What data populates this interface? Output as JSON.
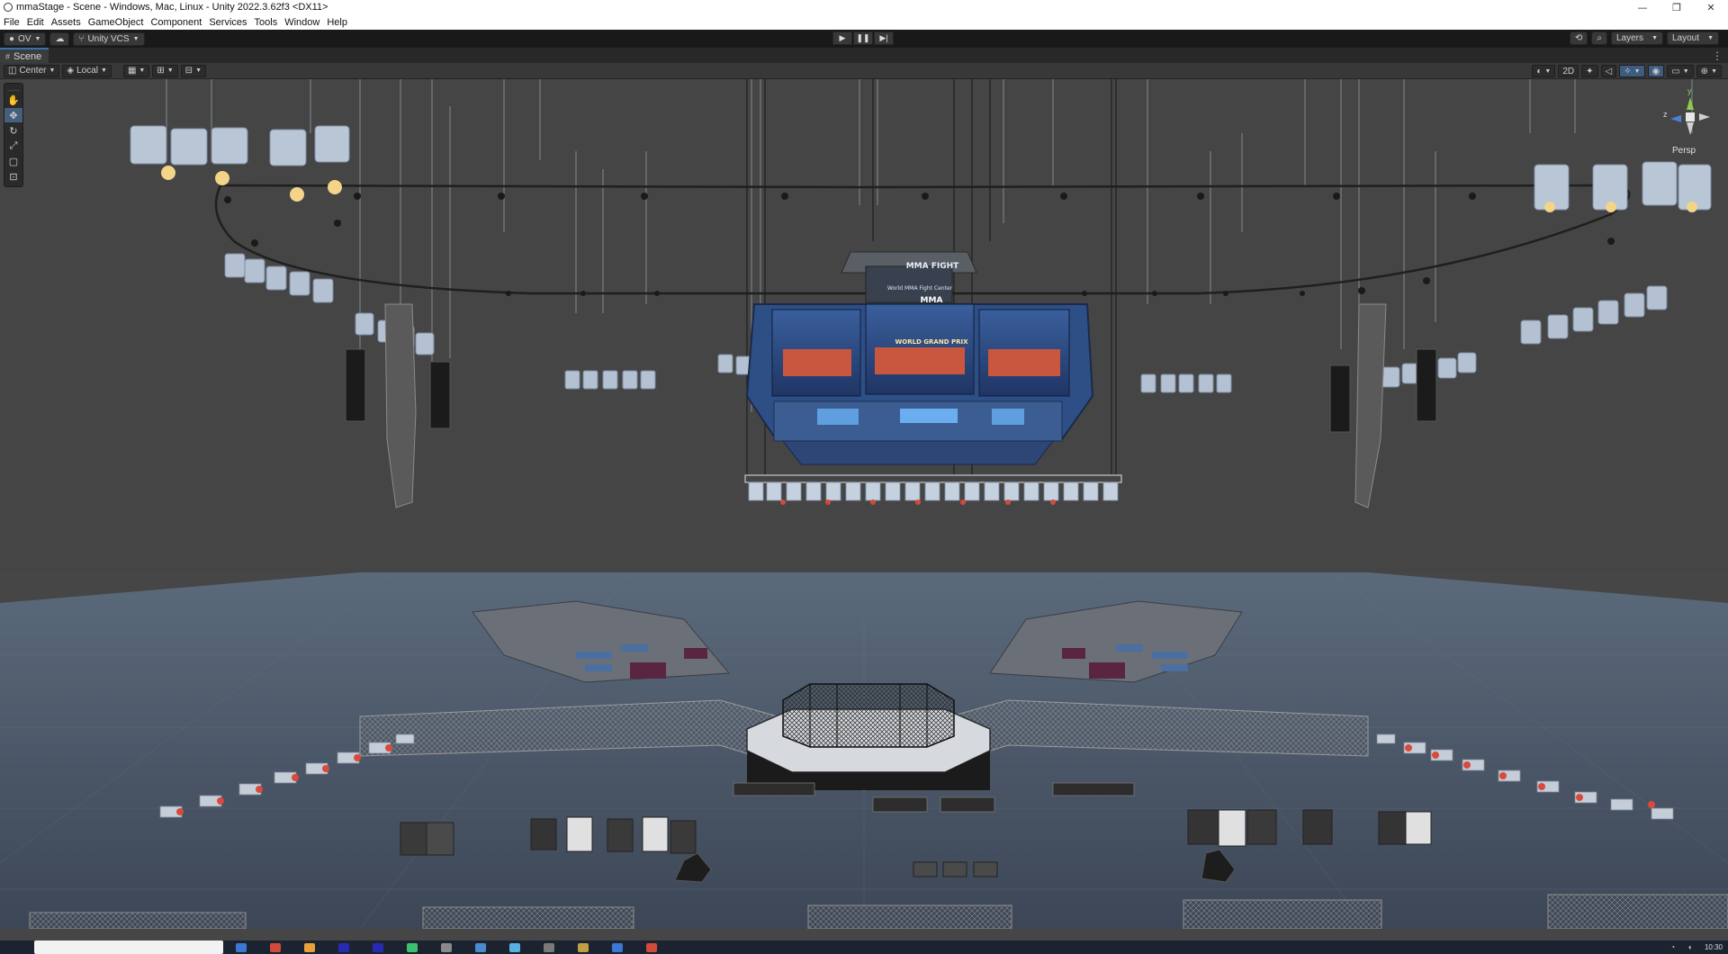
{
  "window": {
    "title": "mmaStage - Scene - Windows, Mac, Linux - Unity 2022.3.62f3 <DX11>",
    "controls": [
      "—",
      "❐",
      "✕"
    ]
  },
  "menubar": {
    "items": [
      "File",
      "Edit",
      "Assets",
      "GameObject",
      "Component",
      "Services",
      "Tools",
      "Window",
      "Help"
    ]
  },
  "toolbar": {
    "account_label": "OV",
    "vcs_label": "Unity VCS",
    "play_icons": [
      "▶",
      "❚❚",
      "▶|"
    ],
    "layers_label": "Layers",
    "layout_label": "Layout"
  },
  "scene_tab": {
    "label": "Scene"
  },
  "scene_toolbar": {
    "pivot_label": "Center",
    "space_label": "Local",
    "mode_2d_label": "2D"
  },
  "gizmo": {
    "projection_label": "Persp",
    "axis_y": "y",
    "axis_z": "z"
  },
  "scene": {
    "screen_title": "MMA FIGHT",
    "screen_subtitle": "World MMA Fight Center",
    "screen_logo": "MMA",
    "event_line": "WORLD GRAND PRIX"
  },
  "taskbar": {
    "time": "10:30"
  },
  "colors": {
    "editor_bg": "#464646",
    "toolbar_bg": "#191919",
    "accent": "#3a72b0",
    "floor": "#4f5d6e",
    "screen_blue": "#2d5aa0"
  }
}
